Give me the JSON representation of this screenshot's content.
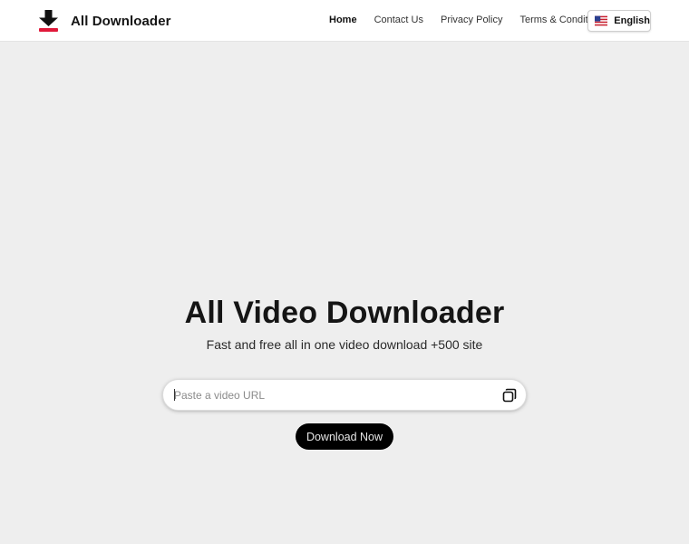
{
  "header": {
    "brand": {
      "name": "All Downloader",
      "icon": "download-arrow-icon",
      "icon_colors": {
        "arrow": "#111111",
        "bar": "#e0193a"
      }
    },
    "nav": [
      {
        "label": "Home",
        "active": true
      },
      {
        "label": "Contact Us",
        "active": false
      },
      {
        "label": "Privacy Policy",
        "active": false
      },
      {
        "label": "Terms & Conditions",
        "active": false
      }
    ],
    "language": {
      "label": "English",
      "icon": "us-flag-icon"
    }
  },
  "hero": {
    "title": "All Video Downloader",
    "subtitle": "Fast and free all in one video download +500 site"
  },
  "form": {
    "url_placeholder": "Paste a video URL",
    "url_value": "",
    "paste_icon": "paste-icon",
    "submit_label": "Download Now"
  },
  "colors": {
    "page_background": "#eeeeee",
    "header_background": "#ffffff",
    "button_background": "#000000",
    "button_text": "#e6e6e6"
  }
}
